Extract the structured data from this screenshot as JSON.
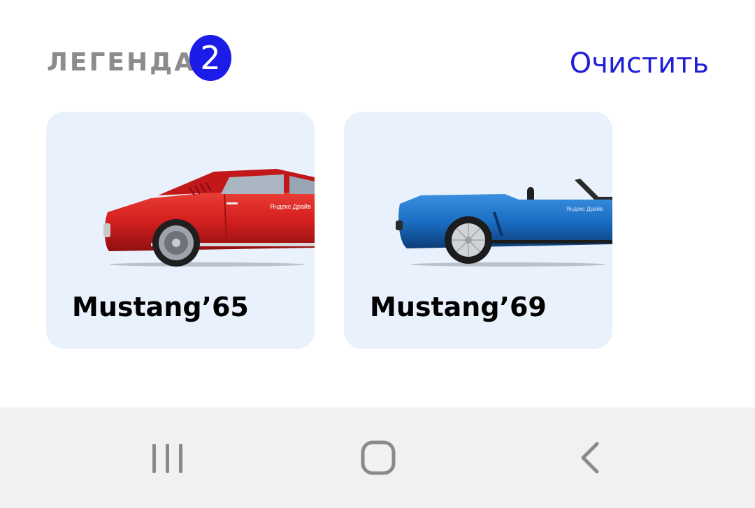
{
  "header": {
    "title": "ЛЕГЕНДА",
    "count": "2",
    "clear_label": "Очистить"
  },
  "cards": [
    {
      "label": "Mustang’65",
      "car_color": "#d61f1f",
      "decal": "Яндекс Драйв"
    },
    {
      "label": "Mustang’69",
      "car_color": "#1a6fc4",
      "decal": "Яндекс Драйв"
    }
  ],
  "navbar": {
    "recent_icon": "recent-apps-icon",
    "home_icon": "home-icon",
    "back_icon": "back-icon"
  },
  "colors": {
    "accent": "#1b1ce8",
    "card_bg": "#e9f1fd",
    "title_gray": "#8c8c8c"
  }
}
